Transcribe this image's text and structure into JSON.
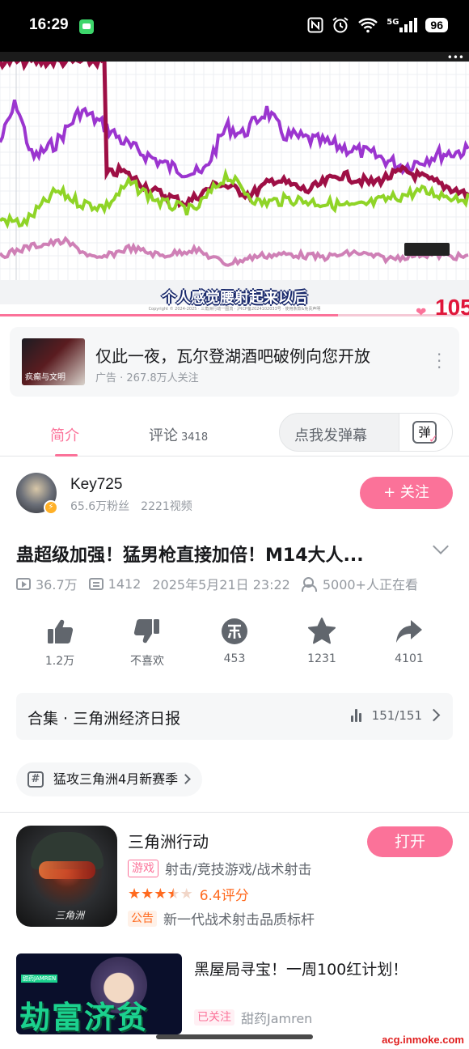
{
  "status_bar": {
    "time": "16:29",
    "network_label": "5G",
    "battery": "96",
    "icons": [
      "message-icon",
      "nfc-icon",
      "alarm-icon",
      "wifi-icon",
      "signal-icon",
      "battery-icon"
    ]
  },
  "video": {
    "subtitle": "个人感觉腰射起来以后",
    "copyright": "Copyright © 2024-2025 · 三角洲行动一图流 · 沪ICP备2024102033号 · 使用条款&免责声明",
    "counter_text": "105",
    "progress": 0.72,
    "colors": {
      "purple": "#9b35cf",
      "crimson": "#9e0f45",
      "green": "#8fd427",
      "pink": "#cf80b6"
    }
  },
  "ad": {
    "thumb_text": "疯癫与文明",
    "title": "仅此一夜，瓦尔登湖酒吧破例向您开放",
    "meta": "广告 · 267.8万人关注"
  },
  "tabs": {
    "intro": "简介",
    "comments": "评论",
    "comments_count": "3418",
    "danmaku_placeholder": "点我发弹幕",
    "danmaku_icon_char": "弹"
  },
  "uploader": {
    "name": "Key725",
    "fans": "65.6万粉丝",
    "videos": "2221视频",
    "follow_label": "+ 关注"
  },
  "video_info": {
    "title": "蛊超级加强！猛男枪直接加倍！M14大人...",
    "views": "36.7万",
    "danmaku": "1412",
    "date": "2025年5月21日 23:22",
    "watching": "5000+人正在看"
  },
  "actions": [
    {
      "label": "1.2万",
      "icon": "like-icon"
    },
    {
      "label": "不喜欢",
      "icon": "dislike-icon"
    },
    {
      "label": "453",
      "icon": "coin-icon"
    },
    {
      "label": "1231",
      "icon": "favorite-icon"
    },
    {
      "label": "4101",
      "icon": "share-icon"
    }
  ],
  "collection": {
    "title": "合集 · 三角洲经济日报",
    "progress": "151/151"
  },
  "tag": {
    "label": "猛攻三角洲4月新赛季"
  },
  "game": {
    "name": "三角洲行动",
    "open_label": "打开",
    "category_chip": "游戏",
    "categories": "射击/竞技游戏/战术射击",
    "rating": "6.4评分",
    "stars_value": 3.5,
    "ad_chip": "公告",
    "tagline": "新一代战术射击品质标杆",
    "logo_text": "三角洲"
  },
  "recommendation": {
    "title": "黑屋局寻宝！一周100红计划！",
    "followed_chip": "已关注",
    "author": "甜药Jamren",
    "thumb_text": "劫富济贫",
    "thumb_brand": "甜药JAMREN"
  },
  "watermark": "acg.inmoke.com"
}
